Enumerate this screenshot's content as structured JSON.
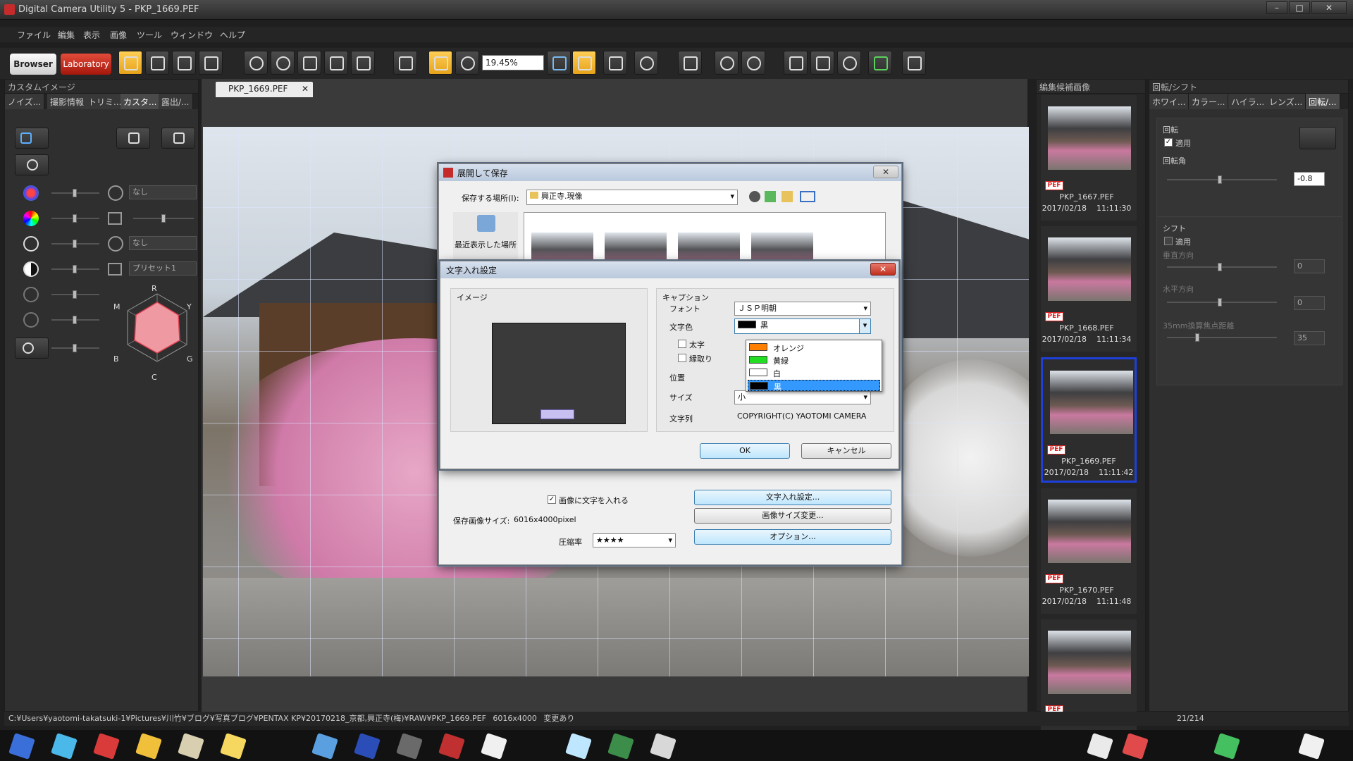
{
  "window": {
    "title": "Digital Camera Utility 5 - PKP_1669.PEF"
  },
  "menu": [
    "ファイル",
    "編集",
    "表示",
    "画像",
    "ツール",
    "ウィンドウ",
    "ヘルプ"
  ],
  "toolbar": {
    "browser_label": "Browser",
    "laboratory_label": "Laboratory",
    "zoom_value": "19.45%"
  },
  "left_panel": {
    "title": "カスタムイメージ",
    "tabs": [
      "ノイズ...",
      "撮影情報",
      "トリミ...",
      "カスタ...",
      "露出/..."
    ],
    "dropdowns": [
      "なし",
      "なし",
      "プリセット1"
    ],
    "radar_labels": {
      "r": "R",
      "y": "Y",
      "g": "G",
      "c": "C",
      "b": "B",
      "m": "M"
    }
  },
  "image_tab": "PKP_1669.PEF",
  "save_dialog": {
    "title": "展開して保存",
    "location_label": "保存する場所(I):",
    "location_value": "興正寺.現像",
    "recent_label": "最近表示した場所",
    "text_in_image_label": "画像に文字を入れる",
    "text_in_image_checked": true,
    "save_size_label": "保存画像サイズ:",
    "save_size_value": "6016x4000pixel",
    "compression_label": "圧縮率",
    "compression_value": "★★★★",
    "text_settings_button": "文字入れ設定...",
    "resize_button": "画像サイズ変更...",
    "options_button": "オプション..."
  },
  "text_dialog": {
    "title": "文字入れ設定",
    "image_label": "イメージ",
    "caption_label": "キャプション",
    "font_label": "フォント",
    "font_value": "ＪＳＰ明朝",
    "color_label": "文字色",
    "color_value": "黒",
    "bold_label": "太字",
    "outline_label": "縁取り",
    "position_label": "位置",
    "size_label": "サイズ",
    "size_value": "小",
    "string_label": "文字列",
    "string_value": "COPYRIGHT(C) YAOTOMI CAMERA",
    "ok": "OK",
    "cancel": "キャンセル",
    "color_options": [
      {
        "label": "オレンジ",
        "color": "#ff7f00"
      },
      {
        "label": "黄緑",
        "color": "#22dd22"
      },
      {
        "label": "白",
        "color": "#ffffff"
      },
      {
        "label": "黒",
        "color": "#000000",
        "selected": true
      }
    ]
  },
  "thumb_panel": {
    "title": "編集候補画像",
    "items": [
      {
        "name": "PKP_1667.PEF",
        "date": "2017/02/18",
        "time": "11:11:30",
        "badge": "PEF"
      },
      {
        "name": "PKP_1668.PEF",
        "date": "2017/02/18",
        "time": "11:11:34",
        "badge": "PEF"
      },
      {
        "name": "PKP_1669.PEF",
        "date": "2017/02/18",
        "time": "11:11:42",
        "badge": "PEF",
        "selected": true
      },
      {
        "name": "PKP_1670.PEF",
        "date": "2017/02/18",
        "time": "11:11:48",
        "badge": "PEF"
      },
      {
        "name": "",
        "date": "",
        "time": "",
        "badge": "PEF"
      }
    ]
  },
  "rot_panel": {
    "title": "回転/シフト",
    "tabs": [
      "ホワイ...",
      "カラー...",
      "ハイラ...",
      "レンズ...",
      "回転/..."
    ],
    "rotation_label": "回転",
    "apply_label": "適用",
    "angle_label": "回転角",
    "angle_value": "-0.8",
    "shift_label": "シフト",
    "shift_apply_label": "適用",
    "vertical_label": "垂直方向",
    "vertical_value": "0",
    "horizontal_label": "水平方向",
    "horizontal_value": "0",
    "focal_label": "35mm換算焦点距離",
    "focal_value": "35"
  },
  "status": {
    "path": "C:¥Users¥yaotomi-takatsuki-1¥Pictures¥川竹¥ブログ¥写真ブログ¥PENTAX KP¥20170218_京都,興正寺(梅)¥RAW¥PKP_1669.PEF",
    "size": "6016x4000",
    "changed": "変更あり",
    "count": "21/214"
  }
}
